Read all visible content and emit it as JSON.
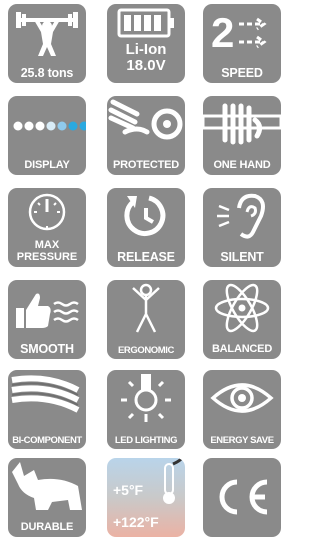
{
  "tiles": {
    "weight": {
      "label": "25.8 tons",
      "icon": "weightlifter-icon"
    },
    "battery": {
      "line1": "Li-Ion",
      "line2": "18.0V",
      "icon": "battery-icon"
    },
    "speed": {
      "digit": "2",
      "label": "SPEED",
      "icon": "speed-arrows-icon"
    },
    "display": {
      "label": "DISPLAY",
      "icon": "led-dots-icon"
    },
    "protected": {
      "label": "PROTECTED",
      "icon": "hand-protected-icon"
    },
    "one_hand": {
      "label": "ONE HAND",
      "icon": "one-hand-grip-icon"
    },
    "max_pressure": {
      "line1": "MAX",
      "line2": "PRESSURE",
      "icon": "pressure-gauge-icon"
    },
    "release": {
      "label": "RELEASE",
      "icon": "release-arrow-icon"
    },
    "silent": {
      "label": "SILENT",
      "icon": "ear-icon"
    },
    "smooth": {
      "label": "SMOOTH",
      "icon": "thumbs-up-waves-icon"
    },
    "ergonomic": {
      "label": "ERGONOMIC",
      "icon": "person-icon"
    },
    "balanced": {
      "label": "BALANCED",
      "icon": "atom-icon"
    },
    "bi_component": {
      "label": "BI-COMPONENT",
      "icon": "bi-component-grip-icon"
    },
    "led_lighting": {
      "label": "LED LIGHTING",
      "icon": "light-bulb-icon"
    },
    "energy_save": {
      "label": "ENERGY SAVE",
      "icon": "eye-icon"
    },
    "durable": {
      "label": "DURABLE",
      "icon": "rhino-icon"
    },
    "temperature": {
      "low": "+5°F",
      "high": "+122°F",
      "icon": "thermometer-icon"
    },
    "ce": {
      "label": "CE",
      "icon": "ce-mark-icon"
    }
  },
  "colors": {
    "tile": "#8a8a8a",
    "icon": "#ffffff",
    "led_blue": "#2aa9e0"
  }
}
